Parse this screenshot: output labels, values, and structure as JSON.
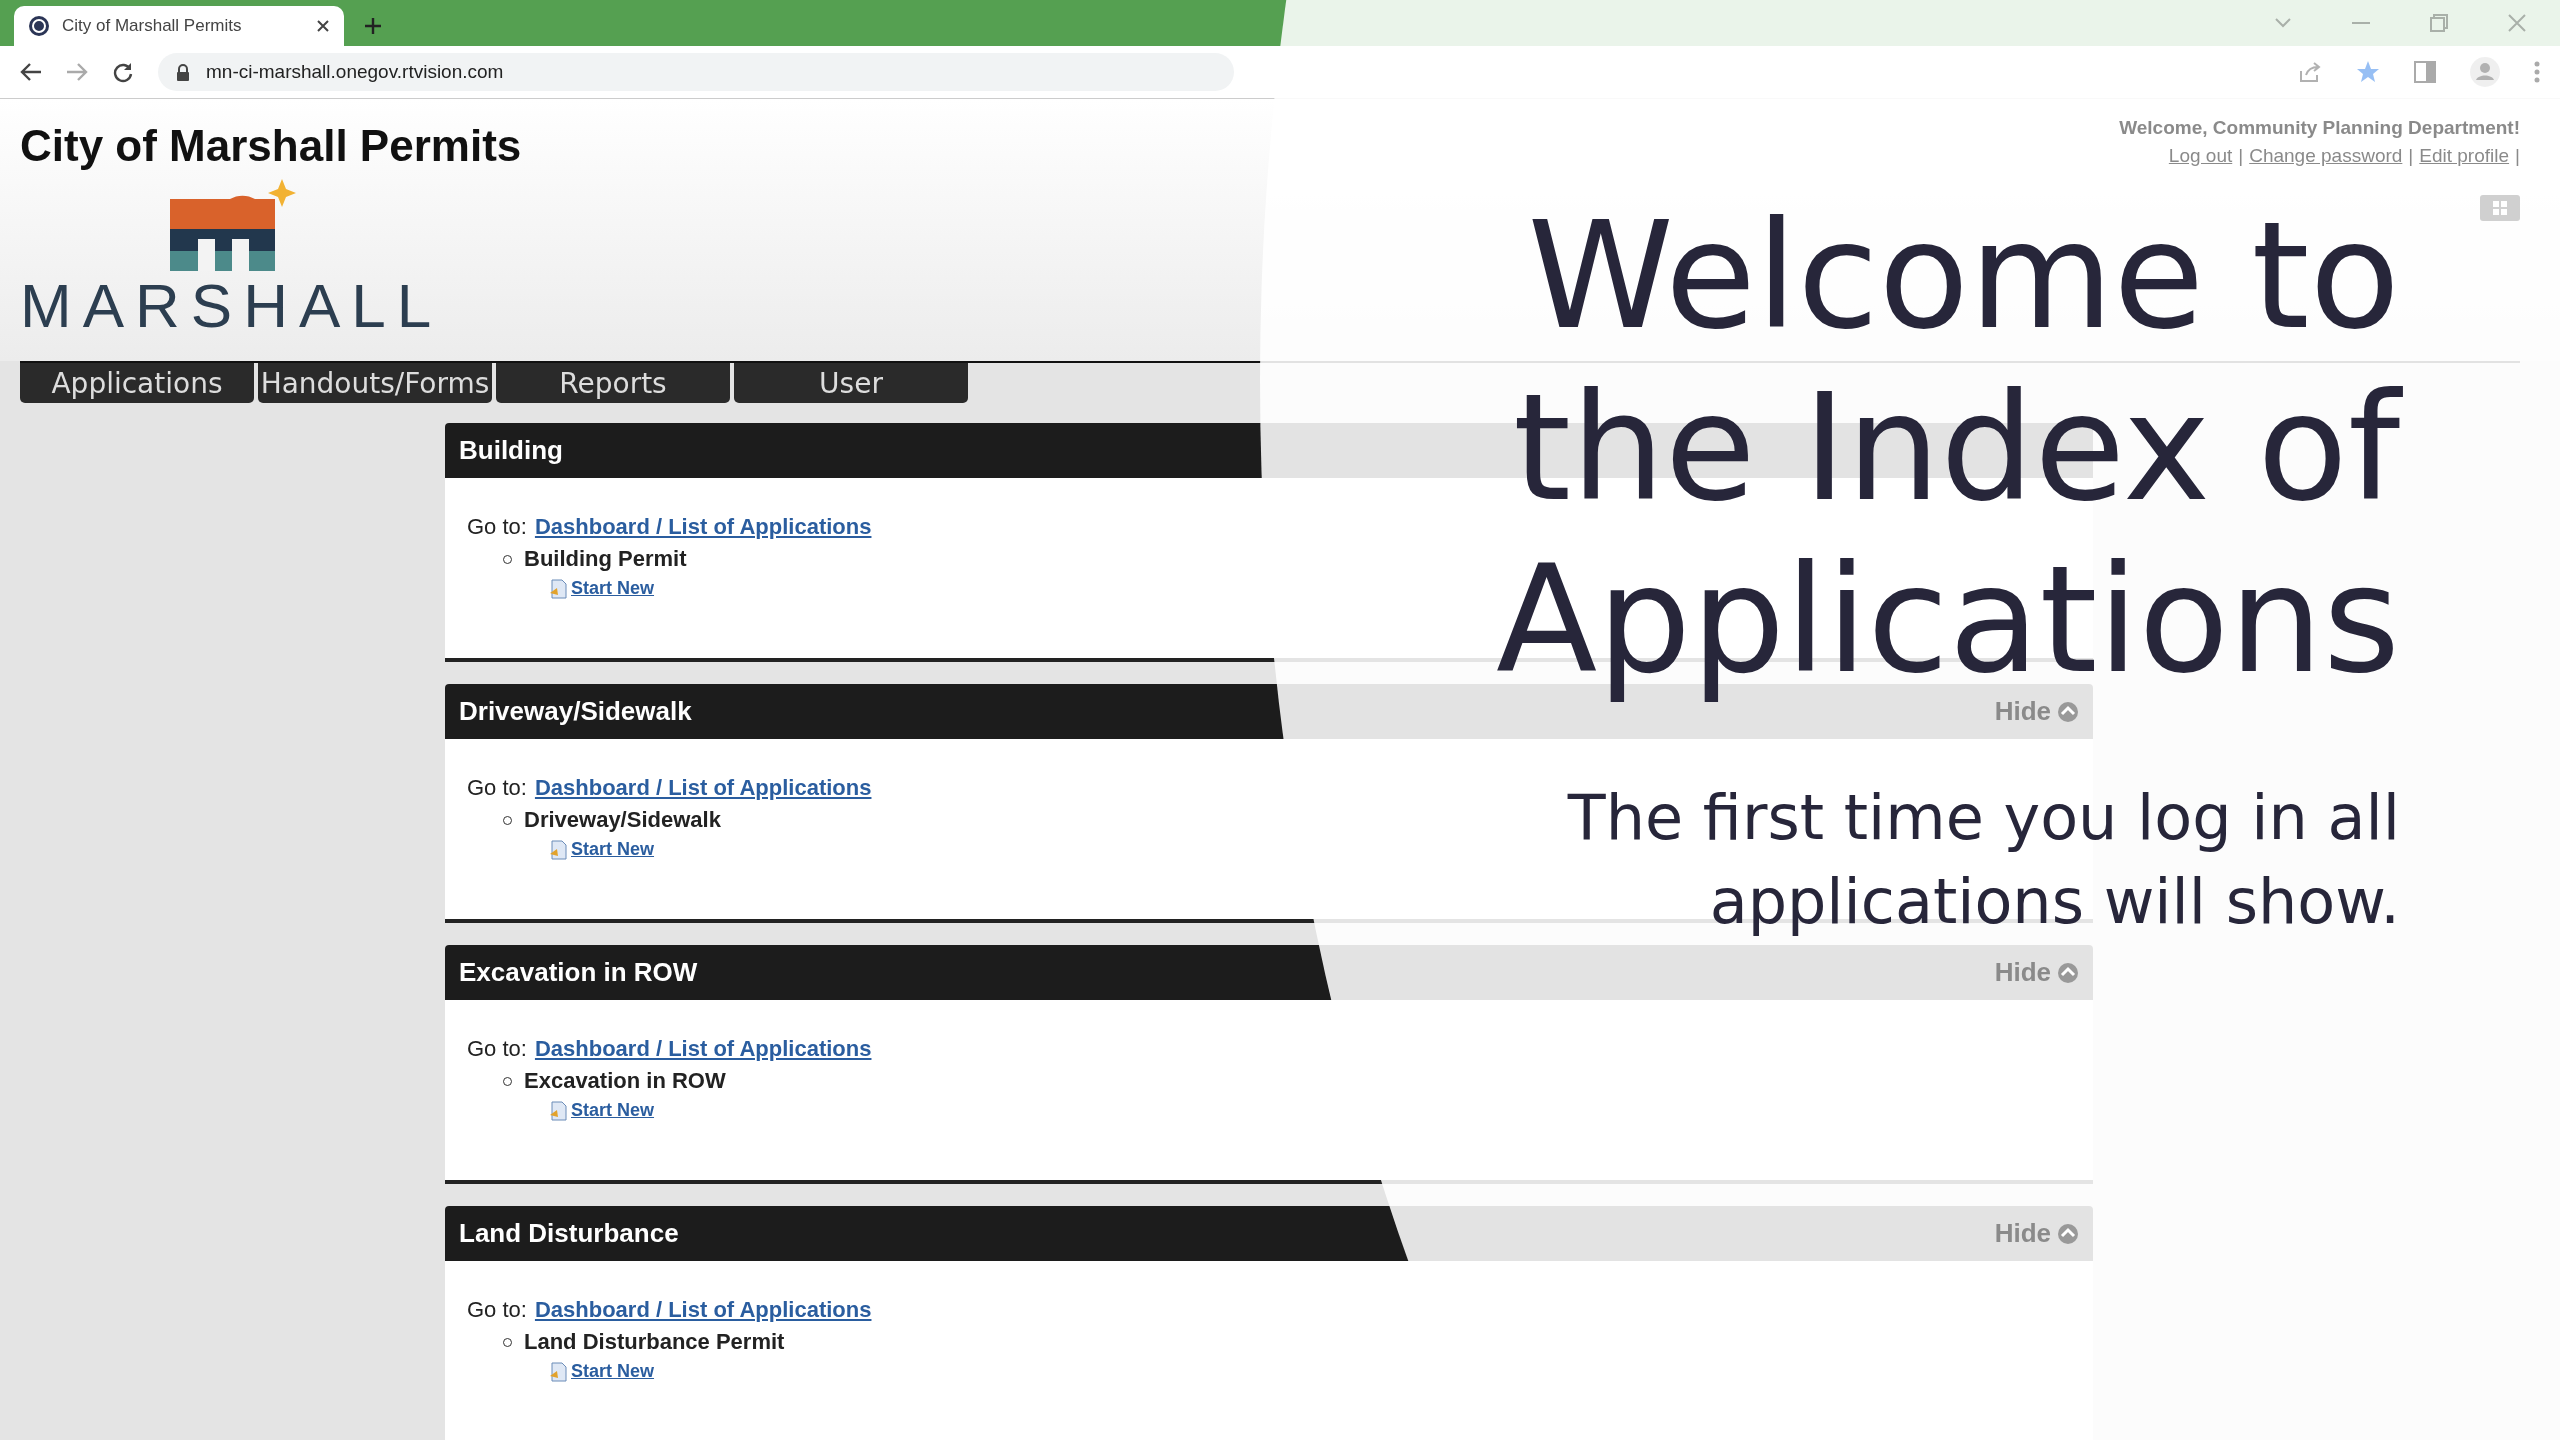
{
  "browser": {
    "tab_title": "City of Marshall Permits",
    "url": "mn-ci-marshall.onegov.rtvision.com"
  },
  "page": {
    "title": "City of Marshall Permits",
    "logo_text": "MARSHALL",
    "welcome": "Welcome, Community Planning Department!",
    "account_links": [
      {
        "label": "Log out",
        "separator": "|"
      },
      {
        "label": "Change password",
        "separator": "|"
      },
      {
        "label": "Edit profile",
        "separator": "|"
      }
    ],
    "nav": [
      "Applications",
      "Handouts/Forms",
      "Reports",
      "User"
    ],
    "sections": [
      {
        "title": "Building",
        "goto_label": "Go to:",
        "goto_link": "Dashboard / List of Applications",
        "item": "Building Permit",
        "start_label": "Start New"
      },
      {
        "title": "Driveway/Sidewalk",
        "goto_label": "Go to:",
        "goto_link": "Dashboard / List of Applications",
        "item": "Driveway/Sidewalk",
        "start_label": "Start New",
        "hide_label": "Hide"
      },
      {
        "title": "Excavation in ROW",
        "goto_label": "Go to:",
        "goto_link": "Dashboard / List of Applications",
        "item": "Excavation in ROW",
        "start_label": "Start New",
        "hide_label": "Hide"
      },
      {
        "title": "Land Disturbance",
        "goto_label": "Go to:",
        "goto_link": "Dashboard / List of Applications",
        "item": "Land Disturbance Permit",
        "start_label": "Start New",
        "hide_label": "Hide"
      }
    ]
  },
  "overlay": {
    "title_lines": [
      "Welcome to",
      "the Index of",
      "Applications"
    ],
    "subtitle_lines": [
      "The first time you log in all",
      "applications will show."
    ]
  }
}
